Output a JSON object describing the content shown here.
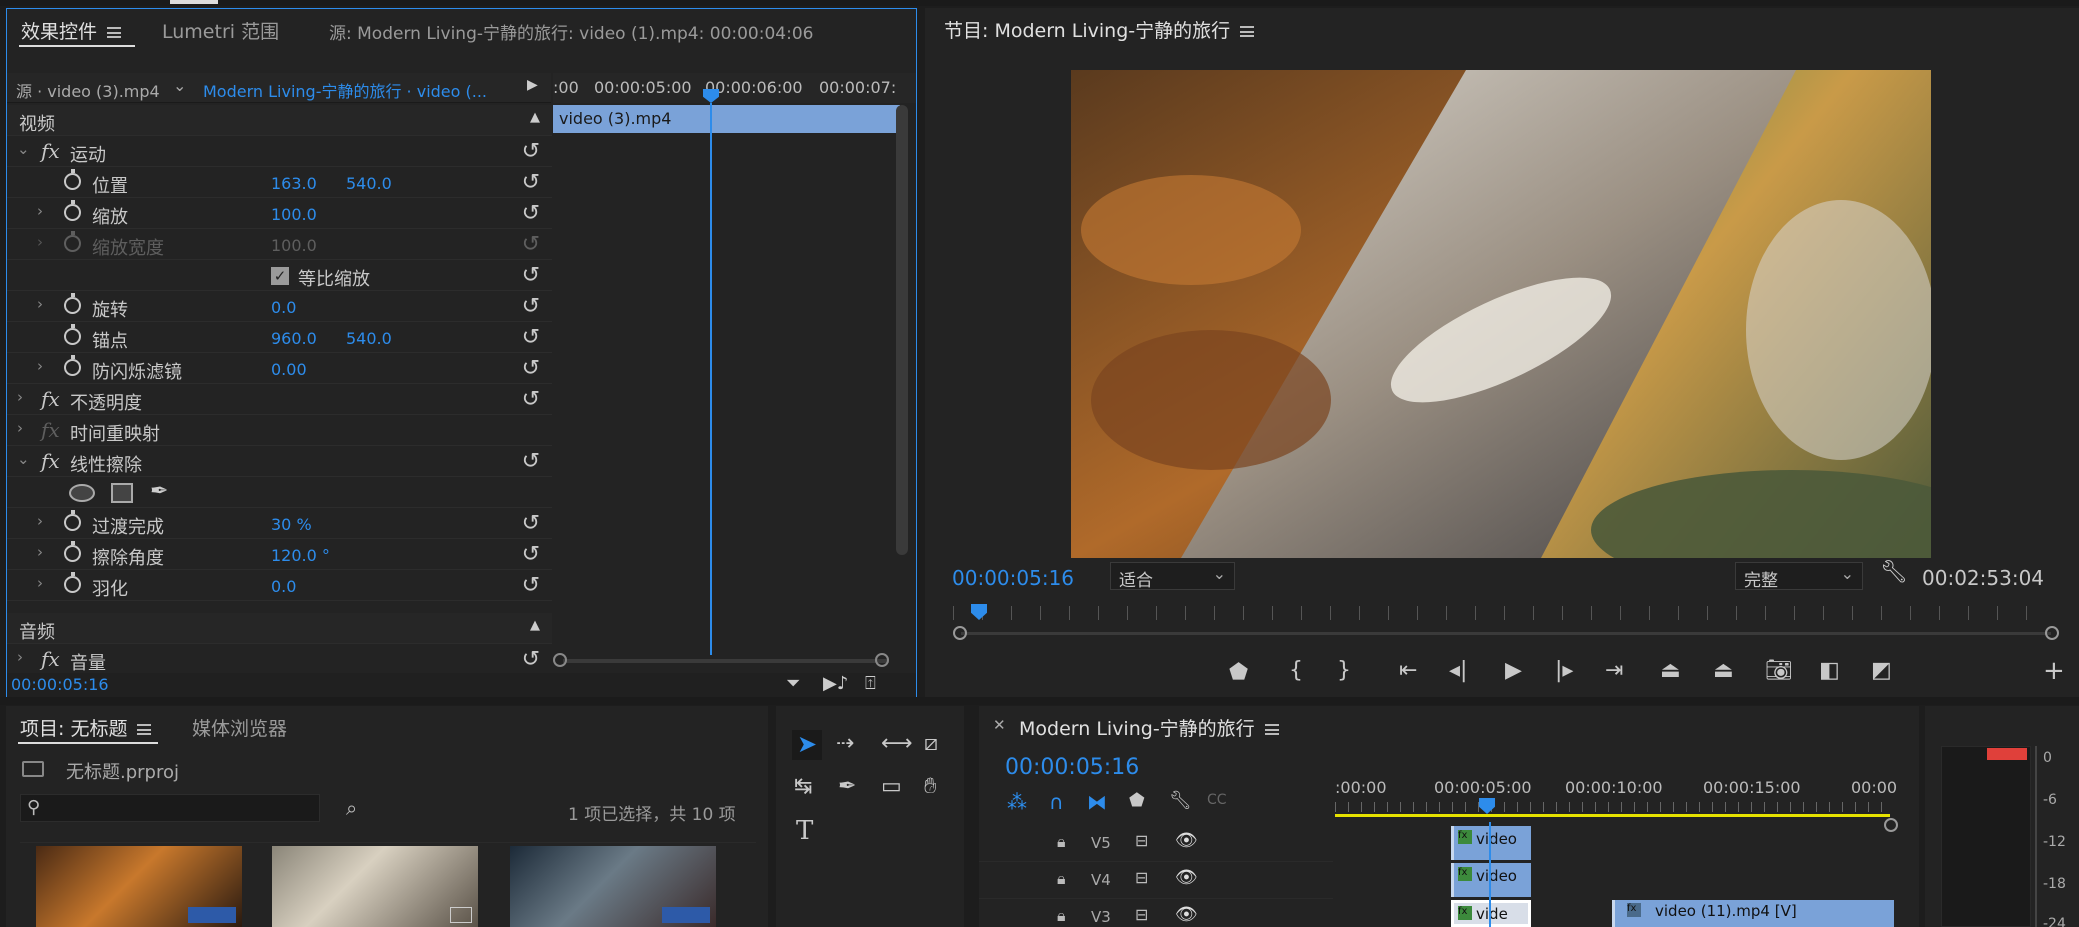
{
  "effect_controls": {
    "tab_active": "效果控件",
    "tab_lumetri": "Lumetri 范围",
    "tab_source": "源: Modern Living-宁静的旅行: video (1).mp4: 00:00:04:06",
    "source_clip": "源 · video (3).mp4",
    "sequence_clip": "Modern Living-宁静的旅行 · video (...",
    "timeline_ruler": [
      ":00",
      "00:00:05:00",
      "00:00:06:00",
      "00:00:07:"
    ],
    "clip_label": "video (3).mp4",
    "section_video": "视频",
    "section_audio": "音频",
    "motion": "运动",
    "position_label": "位置",
    "position_x": "163.0",
    "position_y": "540.0",
    "scale_label": "缩放",
    "scale_value": "100.0",
    "scale_width_label": "缩放宽度",
    "scale_width_value": "100.0",
    "uniform_scale": "等比缩放",
    "rotation_label": "旋转",
    "rotation_value": "0.0",
    "anchor_label": "锚点",
    "anchor_x": "960.0",
    "anchor_y": "540.0",
    "flicker_label": "防闪烁滤镜",
    "flicker_value": "0.00",
    "opacity": "不透明度",
    "time_remap": "时间重映射",
    "linear_wipe": "线性擦除",
    "transition_label": "过渡完成",
    "transition_value": "30 %",
    "wipe_angle_label": "擦除角度",
    "wipe_angle_value": "120.0 °",
    "feather_label": "羽化",
    "feather_value": "0.0",
    "volume": "音量",
    "timecode": "00:00:05:16"
  },
  "program": {
    "title": "节目: Modern Living-宁静的旅行",
    "timecode": "00:00:05:16",
    "fit": "适合",
    "quality": "完整",
    "duration": "00:02:53:04"
  },
  "project": {
    "tab_project": "项目: 无标题",
    "tab_media": "媒体浏览器",
    "file": "无标题.prproj",
    "search_placeholder": "",
    "selection": "1 项已选择，共 10 项"
  },
  "timeline": {
    "title": "Modern Living-宁静的旅行",
    "timecode": "00:00:05:16",
    "ruler": [
      ":00:00",
      "00:00:05:00",
      "00:00:10:00",
      "00:00:15:00",
      "00:00"
    ],
    "tracks": [
      {
        "name": "V5",
        "clip": "video"
      },
      {
        "name": "V4",
        "clip": "video"
      },
      {
        "name": "V3",
        "clip": "vide",
        "clip2": "video (11).mp4 [V]"
      }
    ]
  },
  "meter": {
    "labels": [
      "0",
      "-6",
      "-12",
      "-18",
      "-24"
    ]
  }
}
